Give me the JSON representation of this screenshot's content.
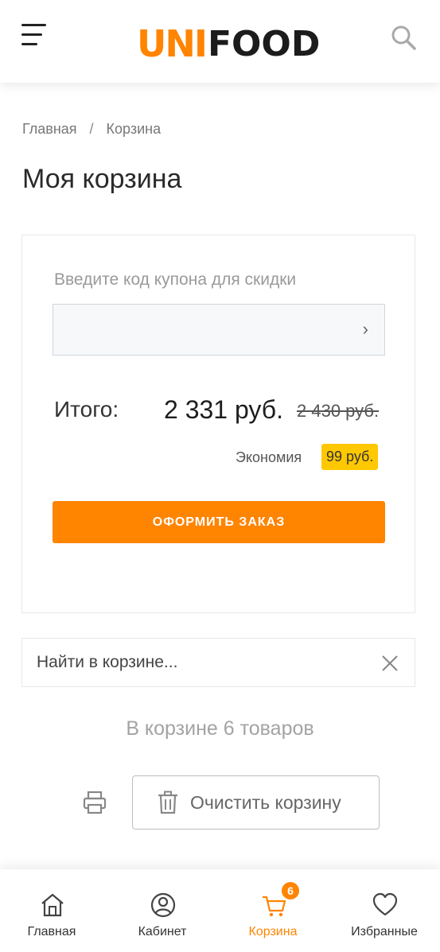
{
  "header": {
    "logo_uni": "UNI",
    "logo_food": "FOOD",
    "menu_icon": "hamburger-menu-icon",
    "search_icon": "search-icon"
  },
  "breadcrumb": {
    "home": "Главная",
    "separator": "/",
    "current": "Корзина"
  },
  "page_title": "Моя корзина",
  "summary": {
    "coupon_label": "Введите код купона для скидки",
    "coupon_value": "",
    "coupon_submit_icon": "chevron-right-icon",
    "total_label": "Итого:",
    "total_price": "2 331 руб.",
    "old_price": "2 430 руб.",
    "savings_label": "Экономия",
    "savings_value": "99 руб.",
    "checkout_label": "ОФОРМИТЬ ЗАКАЗ"
  },
  "cart_search": {
    "placeholder": "Найти в корзине...",
    "clear_icon": "close-icon"
  },
  "items_count": "В корзине 6 товаров",
  "actions": {
    "print_icon": "printer-icon",
    "clear_cart_label": "Очистить корзину",
    "clear_cart_icon": "trash-icon"
  },
  "bottom_nav": {
    "items": [
      {
        "label": "Главная",
        "icon": "home-icon",
        "active": false
      },
      {
        "label": "Кабинет",
        "icon": "user-circle-icon",
        "active": false
      },
      {
        "label": "Корзина",
        "icon": "cart-icon",
        "active": true,
        "badge": "6"
      },
      {
        "label": "Избранные",
        "icon": "heart-icon",
        "active": false
      }
    ]
  },
  "colors": {
    "accent": "#ff8400",
    "badge_yellow": "#ffc800"
  }
}
